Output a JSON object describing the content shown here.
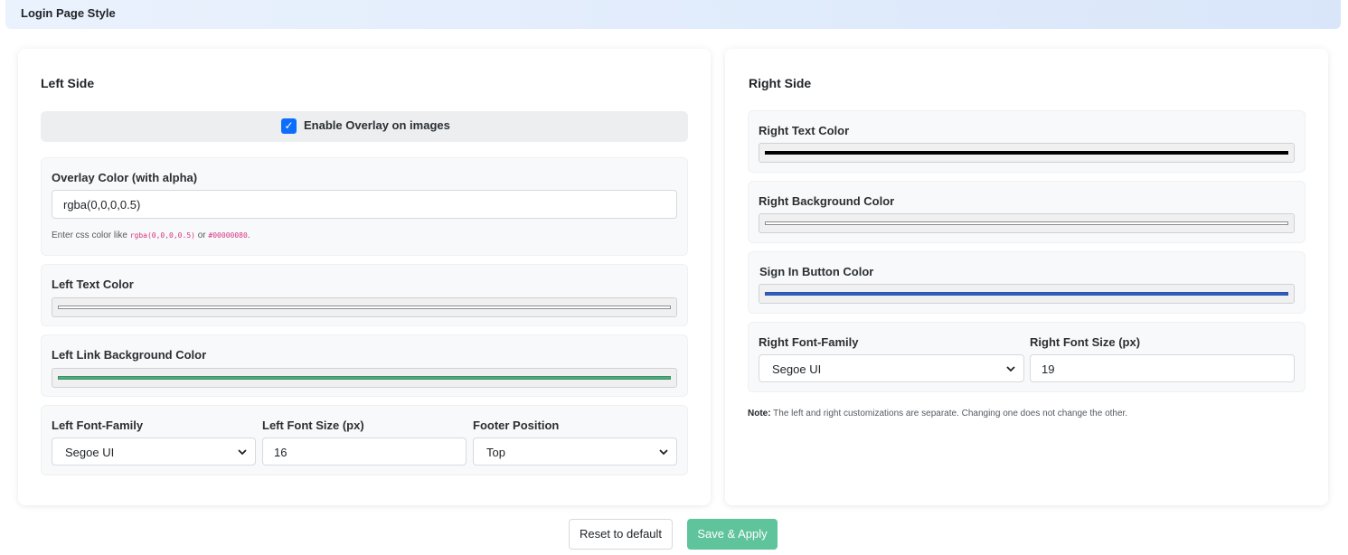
{
  "header": {
    "title": "Login Page Style"
  },
  "left": {
    "title": "Left Side",
    "overlay_enabled_label": "Enable Overlay on images",
    "overlay_enabled": true,
    "overlay_color_label": "Overlay Color (with alpha)",
    "overlay_color_value": "rgba(0,0,0,0.5)",
    "overlay_help_prefix": "Enter css color like",
    "overlay_help_code1": "rgba(0,0,0,0.5)",
    "overlay_help_or": "or",
    "overlay_help_code2": "#00000080",
    "overlay_help_suffix": ".",
    "text_color_label": "Left Text Color",
    "text_color": "#ffffff",
    "link_bg_label": "Left Link Background Color",
    "link_bg_color": "#4caf7d",
    "font_family_label": "Left Font-Family",
    "font_family_value": "Segoe UI",
    "font_size_label": "Left Font Size (px)",
    "font_size_value": "16",
    "footer_position_label": "Footer Position",
    "footer_position_value": "Top"
  },
  "right": {
    "title": "Right Side",
    "text_color_label": "Right Text Color",
    "text_color": "#000000",
    "bg_color_label": "Right Background Color",
    "bg_color": "#ffffff",
    "signin_color_label": "Sign In Button Color",
    "signin_color": "#2f5fc4",
    "font_family_label": "Right Font-Family",
    "font_family_value": "Segoe UI",
    "font_size_label": "Right Font Size (px)",
    "font_size_value": "19",
    "note_bold": "Note:",
    "note_text": "The left and right customizations are separate. Changing one does not change the other."
  },
  "actions": {
    "reset_label": "Reset to default",
    "save_label": "Save & Apply"
  },
  "icons": {
    "checkbox": "checkmark-icon",
    "select": "chevron-down-icon"
  }
}
